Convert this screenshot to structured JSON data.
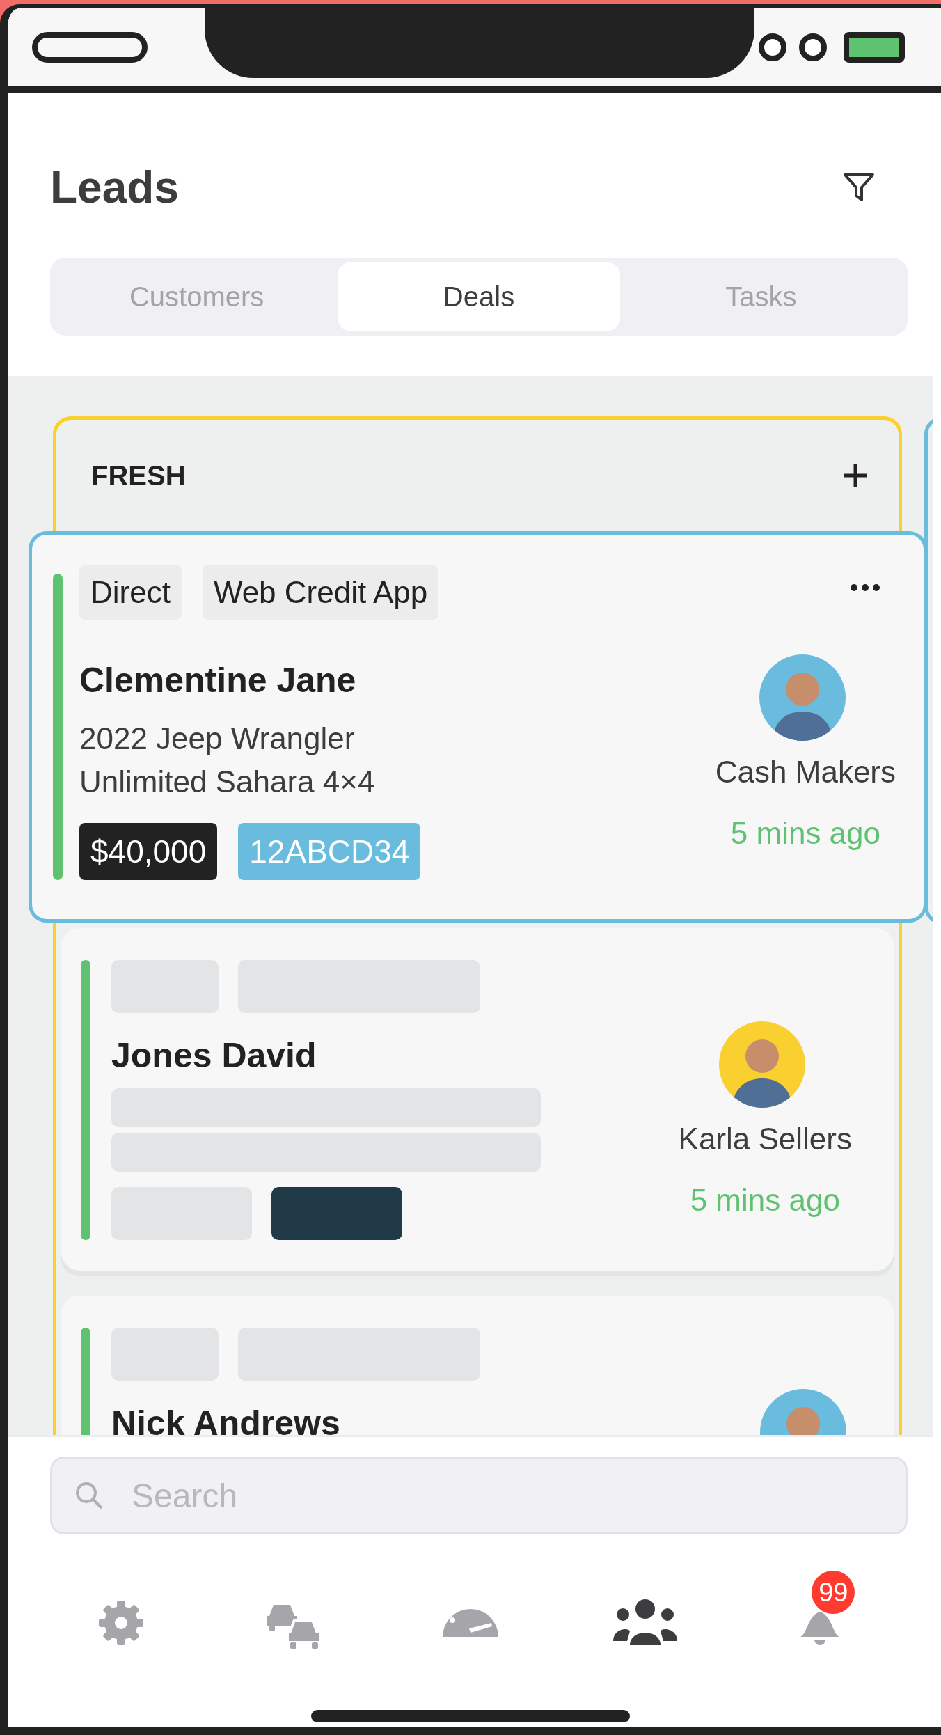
{
  "title": "Leads",
  "tabs": [
    {
      "label": "Customers",
      "selected": false
    },
    {
      "label": "Deals",
      "selected": true
    },
    {
      "label": "Tasks",
      "selected": false
    }
  ],
  "column": {
    "title": "FRESH"
  },
  "cards": [
    {
      "kind": "full",
      "dragging": true,
      "tags": [
        "Direct",
        "Web Credit App"
      ],
      "name": "Clementine Jane",
      "vehicle_lines": [
        "2022 Jeep Wrangler",
        "Unlimited Sahara 4×4"
      ],
      "price": "$40,000",
      "stock": "12ABCD34",
      "seller": "Cash Makers",
      "time": "5 mins ago",
      "color": "#69bcdd"
    },
    {
      "kind": "skeleton",
      "dragging": false,
      "name": "Jones David",
      "seller": "Karla Sellers",
      "time": "5 mins ago",
      "color": "#f9d030"
    },
    {
      "kind": "partial",
      "dragging": false,
      "name": "Nick Andrews",
      "color": "#69bcdd"
    }
  ],
  "search": {
    "placeholder": "Search"
  },
  "nav": [
    {
      "kind": "settings",
      "selected": false
    },
    {
      "kind": "cars",
      "selected": false
    },
    {
      "kind": "dashboard",
      "selected": false
    },
    {
      "kind": "people",
      "selected": true
    },
    {
      "kind": "bell",
      "selected": false,
      "badge": "99"
    }
  ]
}
